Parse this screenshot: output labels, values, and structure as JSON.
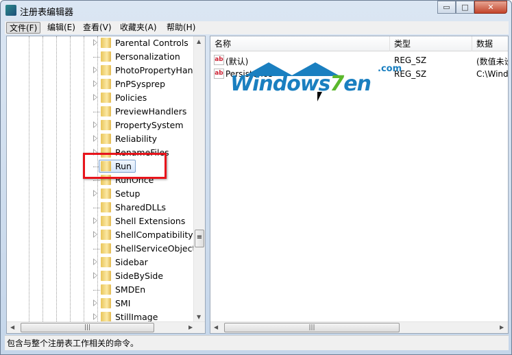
{
  "window": {
    "title": "注册表编辑器",
    "controls": {
      "minimize": "▭",
      "maximize": "□",
      "close": "✕"
    }
  },
  "menu": [
    {
      "label": "文件(F)"
    },
    {
      "label": "编辑(E)"
    },
    {
      "label": "查看(V)"
    },
    {
      "label": "收藏夹(A)"
    },
    {
      "label": "帮助(H)"
    }
  ],
  "tree": {
    "items": [
      {
        "label": "Parental Controls",
        "expandable": true
      },
      {
        "label": "Personalization",
        "expandable": false
      },
      {
        "label": "PhotoPropertyHand",
        "expandable": true
      },
      {
        "label": "PnPSysprep",
        "expandable": true
      },
      {
        "label": "Policies",
        "expandable": true
      },
      {
        "label": "PreviewHandlers",
        "expandable": false
      },
      {
        "label": "PropertySystem",
        "expandable": true
      },
      {
        "label": "Reliability",
        "expandable": true
      },
      {
        "label": "RenameFiles",
        "expandable": true
      },
      {
        "label": "Run",
        "expandable": false,
        "selected": true
      },
      {
        "label": "RunOnce",
        "expandable": false
      },
      {
        "label": "Setup",
        "expandable": true
      },
      {
        "label": "SharedDLLs",
        "expandable": false
      },
      {
        "label": "Shell Extensions",
        "expandable": true
      },
      {
        "label": "ShellCompatibility",
        "expandable": true
      },
      {
        "label": "ShellServiceObjectD",
        "expandable": false
      },
      {
        "label": "Sidebar",
        "expandable": true
      },
      {
        "label": "SideBySide",
        "expandable": true
      },
      {
        "label": "SMDEn",
        "expandable": false
      },
      {
        "label": "SMI",
        "expandable": true
      },
      {
        "label": "StillImage",
        "expandable": true
      }
    ],
    "highlight_color": "#e8141b"
  },
  "values": {
    "columns": [
      "名称",
      "类型",
      "数据"
    ],
    "rows": [
      {
        "name": "(默认)",
        "type": "REG_SZ",
        "data": "(数值未设"
      },
      {
        "name": "Persistence",
        "type": "REG_SZ",
        "data": "C:\\Windo"
      }
    ]
  },
  "watermark": {
    "text": "Windows",
    "seven": "7",
    "suffix": "en",
    "com": ".com"
  },
  "scroll": {
    "grip": "|||",
    "vgrip": "≡"
  },
  "status": "包含与整个注册表工作相关的命令。"
}
